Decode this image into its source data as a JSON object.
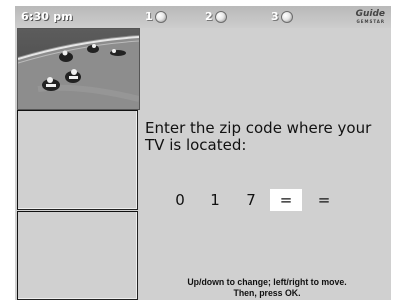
{
  "header": {
    "time": "6:30 pm",
    "steps": [
      "1",
      "2",
      "3"
    ],
    "brand": "Guide",
    "brand_sub": "GEMSTAR"
  },
  "main": {
    "prompt": "Enter the zip code where your TV is located:",
    "zip_digits": [
      "0",
      "1",
      "7",
      "=",
      "="
    ],
    "active_digit_index": 3,
    "help_line1": "Up/down to change; left/right to move.",
    "help_line2": "Then, press OK."
  },
  "colors": {
    "background": "#d0d0d0",
    "active_field": "#ffffff"
  },
  "icons": {
    "step_indicator": "radio-dot-icon",
    "video_preview": "motorcycle-race-video"
  }
}
